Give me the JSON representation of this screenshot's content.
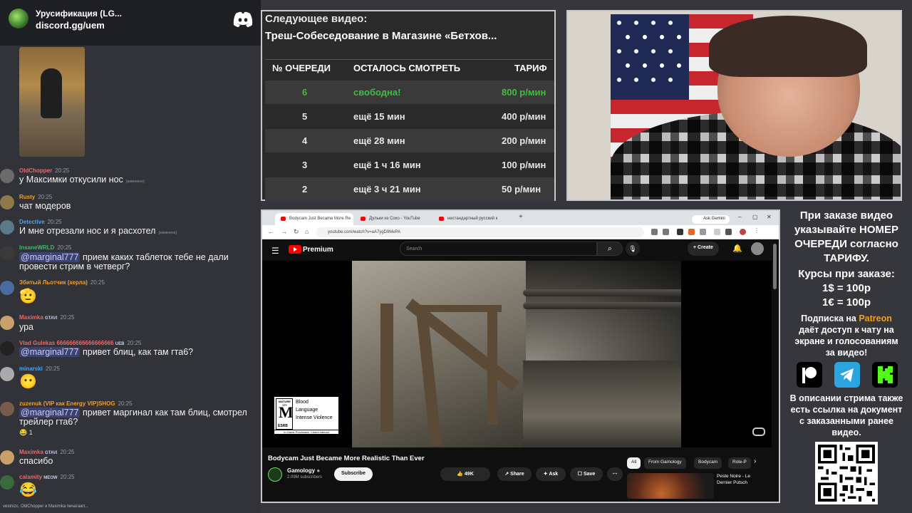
{
  "chat": {
    "server_name": "Урусификация (LG...",
    "invite": "discord.gg/uem",
    "messages": [
      {
        "user": "OldChopper",
        "time": "20:25",
        "color": "#e86a6a",
        "text": "у Максимки откусили нос",
        "edited": "(изменено)"
      },
      {
        "user": "Rusty",
        "time": "20:25",
        "color": "#f0a030",
        "text": "чат модеров"
      },
      {
        "user": "Detective",
        "time": "20:25",
        "color": "#4aa3f0",
        "text": "И мне отрезали нос и я расхотел",
        "edited": "(изменено)"
      },
      {
        "user": "InsaneWRLD",
        "time": "20:25",
        "color": "#3dbb6a",
        "mention": "@marginal777",
        "text": "прием каких  таблеток тебе не дали",
        "text2": "провести стрим в четверг?"
      },
      {
        "user": "Збитый Льотчик (херла)",
        "time": "20:25",
        "color": "#f0a030",
        "text": ""
      },
      {
        "user": "Maximka",
        "badge": "GTAVI",
        "time": "20:25",
        "color": "#e86a6a",
        "text": "ура"
      },
      {
        "user": "Vlad Gulekas 666666666666666666",
        "badge": "UEB",
        "time": "20:25",
        "color": "#e86a6a",
        "mention": "@marginal777",
        "text": "привет блиц, как там гта6?"
      },
      {
        "user": "minarski",
        "time": "20:25",
        "color": "#4aa3f0",
        "text": ""
      },
      {
        "user": "zuzenuk (VIP как Energy VIP)SHOG",
        "time": "20:25",
        "color": "#f0a030",
        "mention": "@marginal777",
        "text": "привет маргинал как там блиц, смотрел",
        "text2": "трейлер гта6?",
        "reaction": "1"
      },
      {
        "user": "Maximka",
        "badge": "GTAVI",
        "time": "20:25",
        "color": "#e86a6a",
        "text": "спасибо"
      },
      {
        "user": "calamity",
        "badge": "MEOW",
        "time": "20:25",
        "color": "#e86a6a",
        "text": ""
      }
    ],
    "typing": "vestnizc, OldChopper и Maximka печатают..."
  },
  "next_video": {
    "label": "Следующее видео:",
    "title": "Треш-Собеседование в Магазине «Бетхов...",
    "headers": [
      "№ ОЧЕРЕДИ",
      "ОСТАЛОСЬ СМОТРЕТЬ",
      "ТАРИФ"
    ],
    "rows": [
      {
        "num": "6",
        "left": "свободна!",
        "rate": "800 р/мин"
      },
      {
        "num": "5",
        "left": "ещё 15 мин",
        "rate": "400 р/мин"
      },
      {
        "num": "4",
        "left": "ещё 28 мин",
        "rate": "200 р/мин"
      },
      {
        "num": "3",
        "left": "ещё 1 ч 16 мин",
        "rate": "100 р/мин"
      },
      {
        "num": "2",
        "left": "ещё 3 ч 21 мин",
        "rate": "50 р/мин"
      }
    ]
  },
  "browser": {
    "tabs": [
      {
        "label": "Bodycam Just Became More Re"
      },
      {
        "label": "Дульки из Соко - YouTube"
      },
      {
        "label": "нестандартный русский к"
      }
    ],
    "gemini": "Ask Gemini",
    "url": "youtube.com/watch?v=aA7ygD9MePA"
  },
  "youtube": {
    "brand": "Premium",
    "search_placeholder": "Search",
    "create": "Create",
    "video_title": "Bodycam Just Became More Realistic Than Ever",
    "channel": "Gamology",
    "subscribers": "2.09M subscribers",
    "subscribe": "Subscribe",
    "likes": "49K",
    "share": "Share",
    "ask": "Ask",
    "save": "Save",
    "chips": [
      "All",
      "From Gamology",
      "Bodycam",
      "Role-P"
    ],
    "rating": {
      "label": "MATURE 17+",
      "letter": "M",
      "org": "ESRB",
      "descriptors": [
        "Blood",
        "Language",
        "Intense Violence"
      ],
      "footer": "In-Game Purchases / Users Interact"
    },
    "rec_title": "Peste Noire - Le Dernier Putsch"
  },
  "info": {
    "line1": "При заказе видео",
    "line2": "указывайте НОМЕР",
    "line3": "ОЧЕРЕДИ согласно",
    "line4": "ТАРИФУ.",
    "rates_label": "Курсы при заказе:",
    "rate1": "1$ = 100р",
    "rate2": "1€ = 100р",
    "sub1_a": "Подписка на ",
    "sub1_b": "Patreon",
    "sub2": "даёт доступ к чату на",
    "sub3": "экране и голосованиям",
    "sub4": "за видео!",
    "desc1": "В описании стрима также",
    "desc2": "есть ссылка на документ",
    "desc3": "с заказанными ранее",
    "desc4": "видео.",
    "colors": {
      "patreon": "#f0a020",
      "telegram": "#2aa5e0",
      "kick": "#53fc18"
    }
  }
}
